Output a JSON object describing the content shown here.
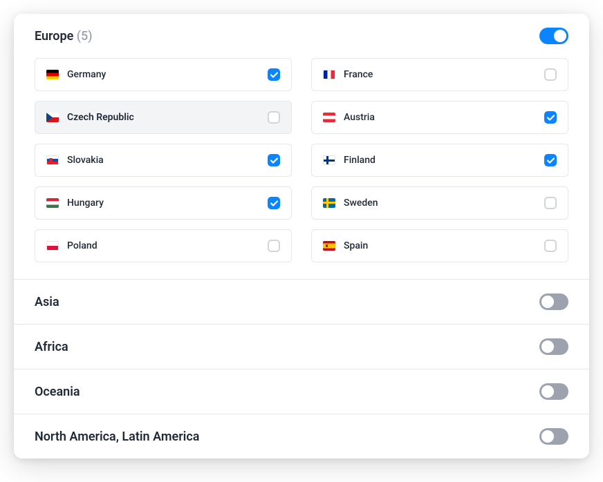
{
  "regions": [
    {
      "name": "Europe",
      "count": 5,
      "enabled": true,
      "expanded": true,
      "countries": [
        {
          "label": "Germany",
          "flag": "germany",
          "checked": true,
          "highlight": false
        },
        {
          "label": "France",
          "flag": "france",
          "checked": false,
          "highlight": false
        },
        {
          "label": "Czech Republic",
          "flag": "czech",
          "checked": false,
          "highlight": true
        },
        {
          "label": "Austria",
          "flag": "austria",
          "checked": true,
          "highlight": false
        },
        {
          "label": "Slovakia",
          "flag": "slovakia",
          "checked": true,
          "highlight": false
        },
        {
          "label": "Finland",
          "flag": "finland",
          "checked": true,
          "highlight": false
        },
        {
          "label": "Hungary",
          "flag": "hungary",
          "checked": true,
          "highlight": false
        },
        {
          "label": "Sweden",
          "flag": "sweden",
          "checked": false,
          "highlight": false
        },
        {
          "label": "Poland",
          "flag": "poland",
          "checked": false,
          "highlight": false
        },
        {
          "label": "Spain",
          "flag": "spain",
          "checked": false,
          "highlight": false
        }
      ]
    },
    {
      "name": "Asia",
      "enabled": false,
      "expanded": false
    },
    {
      "name": "Africa",
      "enabled": false,
      "expanded": false
    },
    {
      "name": "Oceania",
      "enabled": false,
      "expanded": false
    },
    {
      "name": "North America, Latin America",
      "enabled": false,
      "expanded": false
    }
  ]
}
